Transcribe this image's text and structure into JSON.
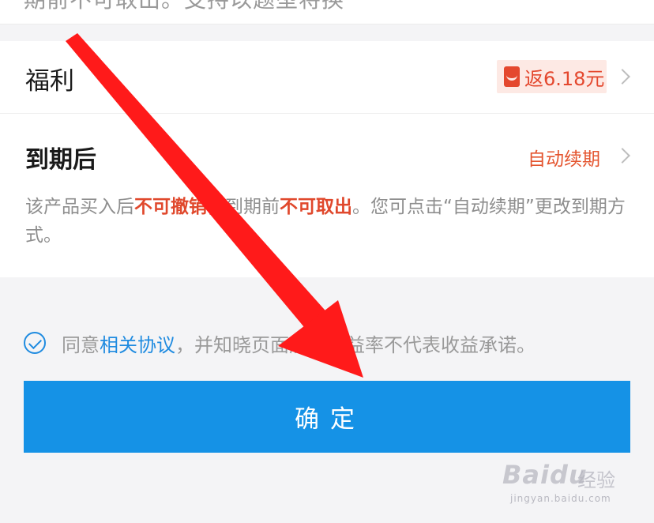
{
  "top": {
    "cut_text": "期前不可取出。支持以题型将换"
  },
  "welfare": {
    "label": "福利",
    "badge_icon": "red-packet-icon",
    "badge_text": "返6.18元"
  },
  "expiry": {
    "label": "到期后",
    "action": "自动续期",
    "desc_1": "该产品买入后",
    "desc_hl_1": "不可撤销",
    "desc_2": "，到期前",
    "desc_hl_2": "不可取出",
    "desc_3": "。您可点击“自动续期”更改到期方式。"
  },
  "agreement": {
    "prefix": "同意",
    "link": "相关协议",
    "suffix": "，并知晓页面展示收益率不代表收益承诺。"
  },
  "confirm_label": "确定",
  "watermark": {
    "brand": "Baidu",
    "cn": "经验",
    "url": "jingyan.baidu.com"
  },
  "colors": {
    "accent_blue": "#1592e6",
    "highlight_red": "#e4482e",
    "arrow_red": "#ff0000"
  }
}
